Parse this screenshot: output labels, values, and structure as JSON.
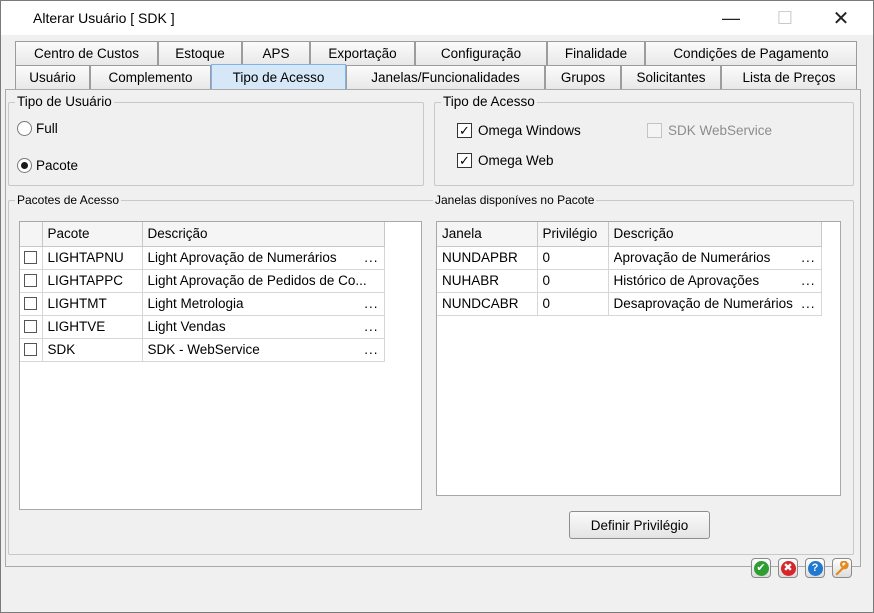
{
  "window": {
    "title": "Alterar Usuário [ SDK ]"
  },
  "tabs_row1": [
    "Centro de Custos",
    "Estoque",
    "APS",
    "Exportação",
    "Configuração",
    "Finalidade",
    "Condições de Pagamento"
  ],
  "tabs_row2": [
    "Usuário",
    "Complemento",
    "Tipo de Acesso",
    "Janelas/Funcionalidades",
    "Grupos",
    "Solicitantes",
    "Lista de Preços"
  ],
  "active_tab": "Tipo de Acesso",
  "tipo_usuario": {
    "legend": "Tipo de Usuário",
    "options": [
      "Full",
      "Pacote"
    ],
    "selected": "Pacote"
  },
  "tipo_acesso": {
    "legend": "Tipo de Acesso",
    "omega_windows": {
      "label": "Omega Windows",
      "checked": true,
      "enabled": true
    },
    "omega_web": {
      "label": "Omega Web",
      "checked": true,
      "enabled": true
    },
    "sdk_webservice": {
      "label": "SDK WebService",
      "checked": false,
      "enabled": false
    }
  },
  "pacotes": {
    "legend": "Pacotes de Acesso",
    "columns": [
      "Pacote",
      "Descrição"
    ],
    "rows": [
      {
        "checked": false,
        "pacote": "LIGHTAPNU",
        "descricao": "Light Aprovação de Numerários",
        "ellipsis": "..."
      },
      {
        "checked": false,
        "pacote": "LIGHTAPPC",
        "descricao": "Light Aprovação de Pedidos de Co...",
        "ellipsis": ""
      },
      {
        "checked": false,
        "pacote": "LIGHTMT",
        "descricao": "Light Metrologia",
        "ellipsis": "..."
      },
      {
        "checked": false,
        "pacote": "LIGHTVE",
        "descricao": "Light Vendas",
        "ellipsis": "..."
      },
      {
        "checked": false,
        "pacote": "SDK",
        "descricao": "SDK - WebService",
        "ellipsis": "..."
      }
    ]
  },
  "janelas": {
    "legend": "Janelas disponíves no Pacote",
    "columns": [
      "Janela",
      "Privilégio",
      "Descrição"
    ],
    "rows": [
      {
        "janela": "NUNDAPBR",
        "privilegio": "0",
        "descricao": "Aprovação de Numerários",
        "ellipsis": "..."
      },
      {
        "janela": "NUHABR",
        "privilegio": "0",
        "descricao": "Histórico de Aprovações",
        "ellipsis": "..."
      },
      {
        "janela": "NUNDCABR",
        "privilegio": "0",
        "descricao": "Desaprovação de Numerários",
        "ellipsis": "..."
      }
    ]
  },
  "buttons": {
    "definir_privilegio": "Definir Privilégio"
  },
  "icons": [
    {
      "name": "confirm-icon",
      "glyph": "✔",
      "color": "#2e9e32"
    },
    {
      "name": "cancel-icon",
      "glyph": "✖",
      "color": "#d9252a"
    },
    {
      "name": "help-icon",
      "glyph": "?",
      "color": "#1f78d1"
    },
    {
      "name": "tools-icon",
      "glyph": "🔧",
      "color": "#e58a1e"
    }
  ]
}
